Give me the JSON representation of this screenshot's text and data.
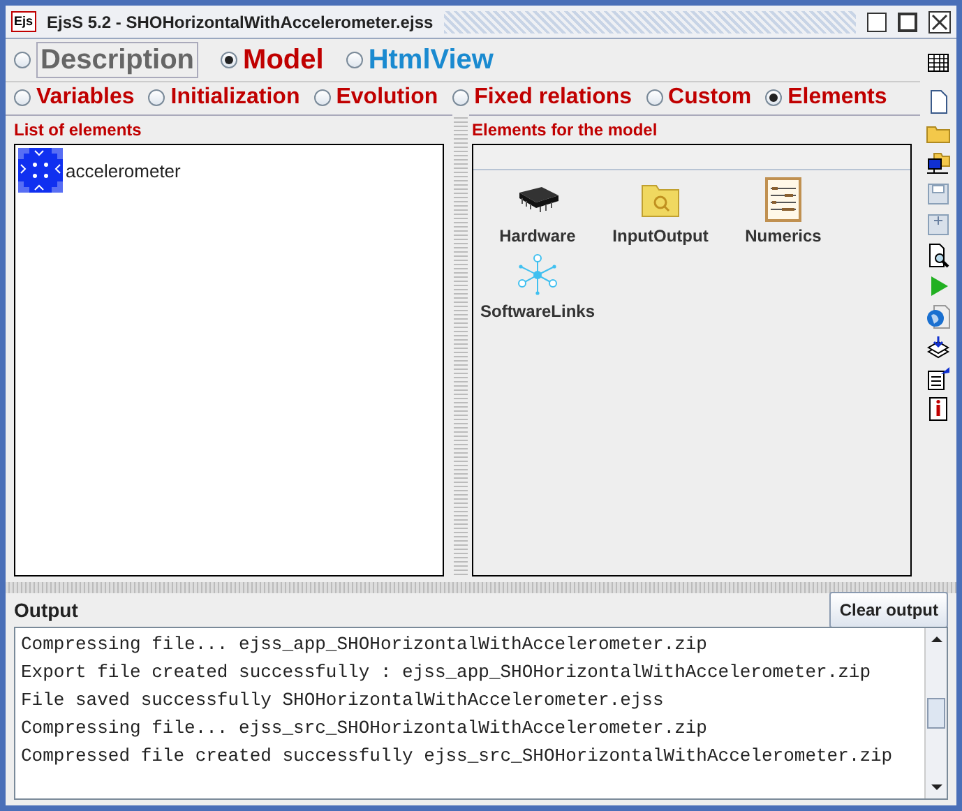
{
  "window": {
    "logo": "Ejs",
    "title": "EjsS 5.2 - SHOHorizontalWithAccelerometer.ejss"
  },
  "main_tabs": [
    {
      "label": "Description",
      "selected": false,
      "color": "#666666"
    },
    {
      "label": "Model",
      "selected": true,
      "color": "#c00000"
    },
    {
      "label": "HtmlView",
      "selected": false,
      "color": "#1a8ad0"
    }
  ],
  "sub_tabs": [
    {
      "label": "Variables",
      "selected": false
    },
    {
      "label": "Initialization",
      "selected": false
    },
    {
      "label": "Evolution",
      "selected": false
    },
    {
      "label": "Fixed relations",
      "selected": false
    },
    {
      "label": "Custom",
      "selected": false
    },
    {
      "label": "Elements",
      "selected": true
    }
  ],
  "list_panel": {
    "title": "List of elements",
    "items": [
      {
        "label": "accelerometer"
      }
    ]
  },
  "elements_panel": {
    "title": "Elements for the model",
    "items": [
      {
        "label": "Hardware",
        "kind": "chip"
      },
      {
        "label": "InputOutput",
        "kind": "folder"
      },
      {
        "label": "Numerics",
        "kind": "abacus"
      },
      {
        "label": "SoftwareLinks",
        "kind": "network"
      }
    ]
  },
  "toolbar": [
    {
      "kind": "table"
    },
    {
      "kind": "new"
    },
    {
      "kind": "open"
    },
    {
      "kind": "remote"
    },
    {
      "kind": "save"
    },
    {
      "kind": "saveas"
    },
    {
      "kind": "preview"
    },
    {
      "kind": "run"
    },
    {
      "kind": "web"
    },
    {
      "kind": "stack"
    },
    {
      "kind": "edit"
    },
    {
      "kind": "info"
    }
  ],
  "output": {
    "title": "Output",
    "button": "Clear output",
    "lines": [
      "Compressing file... ejss_app_SHOHorizontalWithAccelerometer.zip",
      "Export file created successfully : ejss_app_SHOHorizontalWithAccelerometer.zip",
      "File saved successfully SHOHorizontalWithAccelerometer.ejss",
      "Compressing file... ejss_src_SHOHorizontalWithAccelerometer.zip",
      "Compressed file created successfully ejss_src_SHOHorizontalWithAccelerometer.zip"
    ]
  }
}
